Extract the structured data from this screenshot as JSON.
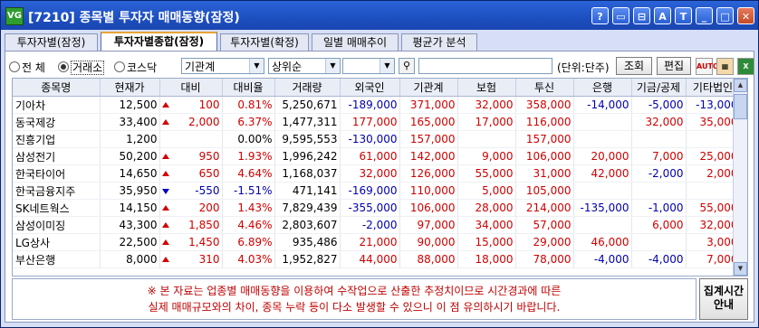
{
  "window": {
    "app_icon_text": "VG",
    "title": "[7210] 종목별 투자자 매매동향(잠정)",
    "buttons": [
      "?",
      "▭",
      "⊟",
      "A",
      "T",
      "_",
      "□",
      "✕"
    ]
  },
  "tabs": [
    {
      "label": "투자자별(잠정)",
      "active": false
    },
    {
      "label": "투자자별종합(잠정)",
      "active": true
    },
    {
      "label": "투자자별(확정)",
      "active": false
    },
    {
      "label": "일별 매매추이",
      "active": false
    },
    {
      "label": "평균가 분석",
      "active": false
    }
  ],
  "toolbar": {
    "market_options": [
      {
        "label": "전 체",
        "selected": false
      },
      {
        "label": "거래소",
        "selected": true
      },
      {
        "label": "코스닥",
        "selected": false
      }
    ],
    "investor_select": "기관계",
    "rank_select": "상위순",
    "extra_select": "",
    "unit_label": "(단위:단주)",
    "query_button": "조회",
    "edit_button": "편집",
    "auto_icon_text": "AUTO"
  },
  "table": {
    "headers": [
      "종목명",
      "현재가",
      "대비",
      "대비율",
      "거래량",
      "외국인",
      "기관계",
      "보험",
      "투신",
      "은행",
      "기금/공제",
      "기타법인"
    ],
    "rows": [
      {
        "name": "기아차",
        "price": "12,500",
        "dir": "up",
        "change": "100",
        "rate": "0.81%",
        "volume": "5,250,671",
        "foreign": "-189,000",
        "inst": "371,000",
        "insurance": "32,000",
        "trust": "358,000",
        "bank": "-14,000",
        "fund": "-5,000",
        "other": "-13,000"
      },
      {
        "name": "동국제강",
        "price": "33,400",
        "dir": "up",
        "change": "2,000",
        "rate": "6.37%",
        "volume": "1,477,311",
        "foreign": "177,000",
        "inst": "165,000",
        "insurance": "17,000",
        "trust": "116,000",
        "bank": "",
        "fund": "32,000",
        "other": "35,000"
      },
      {
        "name": "진흥기업",
        "price": "1,200",
        "dir": "flat",
        "change": "",
        "rate": "0.00%",
        "volume": "9,595,553",
        "foreign": "-130,000",
        "inst": "157,000",
        "insurance": "",
        "trust": "157,000",
        "bank": "",
        "fund": "",
        "other": ""
      },
      {
        "name": "삼성전기",
        "price": "50,200",
        "dir": "up",
        "change": "950",
        "rate": "1.93%",
        "volume": "1,996,242",
        "foreign": "61,000",
        "inst": "142,000",
        "insurance": "9,000",
        "trust": "106,000",
        "bank": "20,000",
        "fund": "7,000",
        "other": "25,000"
      },
      {
        "name": "한국타이어",
        "price": "14,650",
        "dir": "up",
        "change": "650",
        "rate": "4.64%",
        "volume": "1,168,037",
        "foreign": "32,000",
        "inst": "126,000",
        "insurance": "55,000",
        "trust": "31,000",
        "bank": "42,000",
        "fund": "-2,000",
        "other": "2,000"
      },
      {
        "name": "한국금융지주",
        "price": "35,950",
        "dir": "dn",
        "change": "-550",
        "rate": "-1.51%",
        "volume": "471,141",
        "foreign": "-169,000",
        "inst": "110,000",
        "insurance": "5,000",
        "trust": "105,000",
        "bank": "",
        "fund": "",
        "other": ""
      },
      {
        "name": "SK네트웍스",
        "price": "14,150",
        "dir": "up",
        "change": "200",
        "rate": "1.43%",
        "volume": "7,829,439",
        "foreign": "-355,000",
        "inst": "106,000",
        "insurance": "28,000",
        "trust": "214,000",
        "bank": "-135,000",
        "fund": "-1,000",
        "other": "55,000"
      },
      {
        "name": "삼성이미징",
        "price": "43,300",
        "dir": "up",
        "change": "1,850",
        "rate": "4.46%",
        "volume": "2,803,607",
        "foreign": "-2,000",
        "inst": "97,000",
        "insurance": "34,000",
        "trust": "57,000",
        "bank": "",
        "fund": "6,000",
        "other": "32,000"
      },
      {
        "name": "LG상사",
        "price": "22,500",
        "dir": "up",
        "change": "1,450",
        "rate": "6.89%",
        "volume": "935,486",
        "foreign": "21,000",
        "inst": "90,000",
        "insurance": "15,000",
        "trust": "29,000",
        "bank": "46,000",
        "fund": "",
        "other": "3,000"
      },
      {
        "name": "부산은행",
        "price": "8,000",
        "dir": "up",
        "change": "310",
        "rate": "4.03%",
        "volume": "1,952,827",
        "foreign": "44,000",
        "inst": "88,000",
        "insurance": "18,000",
        "trust": "78,000",
        "bank": "-4,000",
        "fund": "-4,000",
        "other": "7,000"
      }
    ]
  },
  "notice": {
    "line1": "※ 본 자료는 업종별 매매동향을 이용하여 수작업으로 산출한 추정치이므로 시간경과에 따른",
    "line2": "실제 매매규모와의 차이, 종목 누락 등이 다소 발생할 수 있으니 이 점 유의하시기 바랍니다.",
    "agg_button_line1": "집계시간",
    "agg_button_line2": "안내"
  },
  "colors": {
    "up": "#d00000",
    "down": "#0000b0",
    "title_bar": "#1d4fc0",
    "notice_text": "#c00000"
  }
}
